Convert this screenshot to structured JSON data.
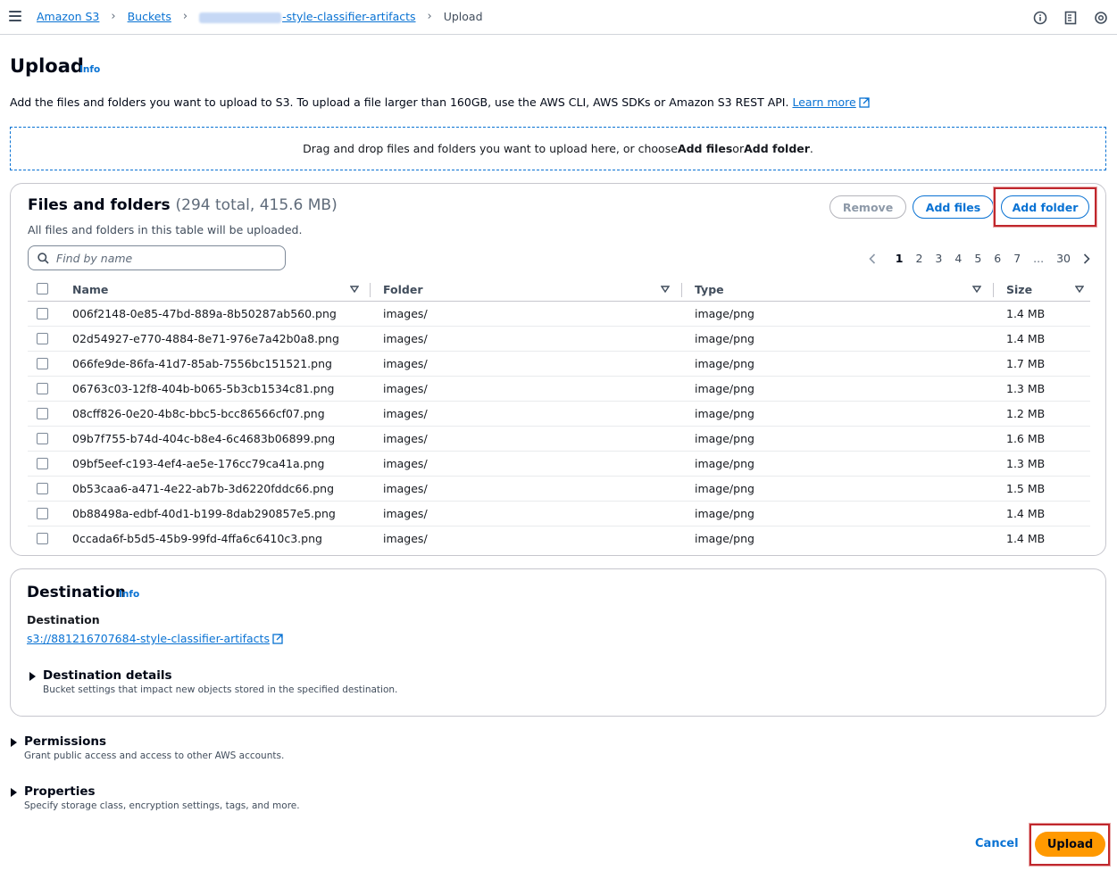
{
  "breadcrumb": {
    "items": [
      "Amazon S3",
      "Buckets",
      "-style-classifier-artifacts"
    ],
    "current": "Upload"
  },
  "header": {
    "title": "Upload",
    "info": "Info",
    "intro": "Add the files and folders you want to upload to S3. To upload a file larger than 160GB, use the AWS CLI, AWS SDKs or Amazon S3 REST API.",
    "learn_more": "Learn more"
  },
  "dropzone": {
    "prefix": "Drag and drop files and folders you want to upload here, or choose ",
    "add_files": "Add files",
    "or": " or ",
    "add_folder": "Add folder",
    "suffix": "."
  },
  "files": {
    "title": "Files and folders",
    "count": "(294 total, 415.6 MB)",
    "subtitle": "All files and folders in this table will be uploaded.",
    "buttons": {
      "remove": "Remove",
      "add_files": "Add files",
      "add_folder": "Add folder"
    },
    "search_placeholder": "Find by name",
    "pagination": {
      "pages": [
        "1",
        "2",
        "3",
        "4",
        "5",
        "6",
        "7",
        "...",
        "30"
      ],
      "current": "1"
    },
    "columns": [
      "Name",
      "Folder",
      "Type",
      "Size"
    ],
    "rows": [
      {
        "name": "006f2148-0e85-47bd-889a-8b50287ab560.png",
        "folder": "images/",
        "type": "image/png",
        "size": "1.4 MB"
      },
      {
        "name": "02d54927-e770-4884-8e71-976e7a42b0a8.png",
        "folder": "images/",
        "type": "image/png",
        "size": "1.4 MB"
      },
      {
        "name": "066fe9de-86fa-41d7-85ab-7556bc151521.png",
        "folder": "images/",
        "type": "image/png",
        "size": "1.7 MB"
      },
      {
        "name": "06763c03-12f8-404b-b065-5b3cb1534c81.png",
        "folder": "images/",
        "type": "image/png",
        "size": "1.3 MB"
      },
      {
        "name": "08cff826-0e20-4b8c-bbc5-bcc86566cf07.png",
        "folder": "images/",
        "type": "image/png",
        "size": "1.2 MB"
      },
      {
        "name": "09b7f755-b74d-404c-b8e4-6c4683b06899.png",
        "folder": "images/",
        "type": "image/png",
        "size": "1.6 MB"
      },
      {
        "name": "09bf5eef-c193-4ef4-ae5e-176cc79ca41a.png",
        "folder": "images/",
        "type": "image/png",
        "size": "1.3 MB"
      },
      {
        "name": "0b53caa6-a471-4e22-ab7b-3d6220fddc66.png",
        "folder": "images/",
        "type": "image/png",
        "size": "1.5 MB"
      },
      {
        "name": "0b88498a-edbf-40d1-b199-8dab290857e5.png",
        "folder": "images/",
        "type": "image/png",
        "size": "1.4 MB"
      },
      {
        "name": "0ccada6f-b5d5-45b9-99fd-4ffa6c6410c3.png",
        "folder": "images/",
        "type": "image/png",
        "size": "1.4 MB"
      }
    ]
  },
  "destination": {
    "title": "Destination",
    "info": "Info",
    "label": "Destination",
    "uri": "s3://881216707684-style-classifier-artifacts",
    "details_title": "Destination details",
    "details_desc": "Bucket settings that impact new objects stored in the specified destination."
  },
  "permissions": {
    "title": "Permissions",
    "desc": "Grant public access and access to other AWS accounts."
  },
  "properties": {
    "title": "Properties",
    "desc": "Specify storage class, encryption settings, tags, and more."
  },
  "footer": {
    "cancel": "Cancel",
    "upload": "Upload"
  },
  "colors": {
    "link": "#0972d3",
    "primary": "#ff9900",
    "highlight": "#c0272d"
  }
}
